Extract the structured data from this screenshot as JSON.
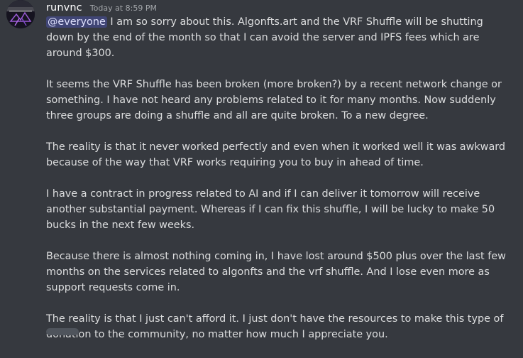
{
  "message": {
    "author": "runvnc",
    "timestamp": "Today at 8:59 PM",
    "mention": "@everyone",
    "paragraphs": [
      " I am so sorry about this. Algonfts.art and the VRF Shuffle will be shutting down by the end of the month so that I can avoid the server and IPFS fees which are around $300.",
      "It seems the VRF Shuffle has been broken (more broken?) by a recent network change or something. I have not heard any problems related to it for many months. Now suddenly three groups are doing a shuffle and all are quite broken. To a new degree.",
      "The reality is that it never worked perfectly and even when it worked well it was awkward because of the way that VRF works requiring you to buy in ahead of time.",
      "I have a contract in progress related to AI and if I can deliver it tomorrow will receive another substantial payment. Whereas if I can fix this shuffle, I will be lucky to make 50 bucks in the next few weeks.",
      "Because there is almost nothing coming in, I have lost around $500 plus over the last few months on the services related to algonfts and the vrf shuffle. And I lose even more as support requests come in.",
      "The reality is that I just can't afford it. I just don't have the resources to make this type of donation to the community, no matter how much I appreciate you."
    ]
  },
  "colors": {
    "background": "#36393f",
    "text": "#dcddde",
    "username": "#ffffff",
    "timestamp": "#a3a6aa",
    "mention_bg": "rgba(88,101,242,0.30)",
    "mention_text": "#dee0fc"
  },
  "icons": {
    "avatar": "user-avatar-image"
  }
}
